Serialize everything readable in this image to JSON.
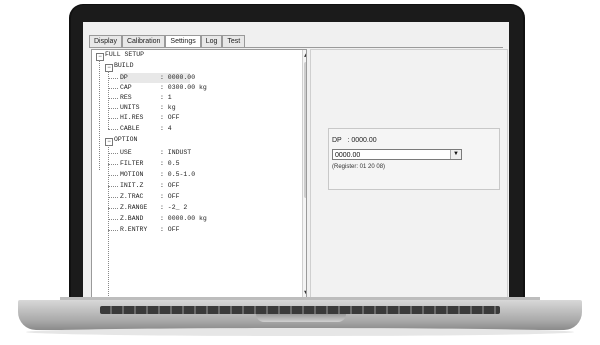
{
  "tabs": [
    "Display",
    "Calibration",
    "Settings",
    "Log",
    "Test"
  ],
  "active_tab_index": 2,
  "tree": {
    "root": "FULL SETUP",
    "build_group": "BUILD",
    "build_items": [
      {
        "key": "DP",
        "value": ": 0000.00"
      },
      {
        "key": "CAP",
        "value": ": 0300.00 kg"
      },
      {
        "key": "RES",
        "value": ": 1"
      },
      {
        "key": "UNITS",
        "value": ": kg"
      },
      {
        "key": "HI.RES",
        "value": ": OFF"
      },
      {
        "key": "CABLE",
        "value": ": 4"
      }
    ],
    "option_group": "OPTION",
    "option_items": [
      {
        "key": "USE",
        "value": ": INDUST"
      },
      {
        "key": "FILTER",
        "value": ": 0.5"
      },
      {
        "key": "MOTION",
        "value": ": 0.5-1.0"
      },
      {
        "key": "INIT.Z",
        "value": ": OFF"
      },
      {
        "key": "Z.TRAC",
        "value": ": OFF"
      },
      {
        "key": "Z.RANGE",
        "value": ": -2_ 2"
      },
      {
        "key": "Z.BAND",
        "value": ": 0000.00 kg"
      },
      {
        "key": "R.ENTRY",
        "value": ": OFF"
      }
    ]
  },
  "detail": {
    "label": "DP   : 0000.00",
    "combo_value": "0000.00",
    "register": "(Register: 01 20 08)"
  }
}
